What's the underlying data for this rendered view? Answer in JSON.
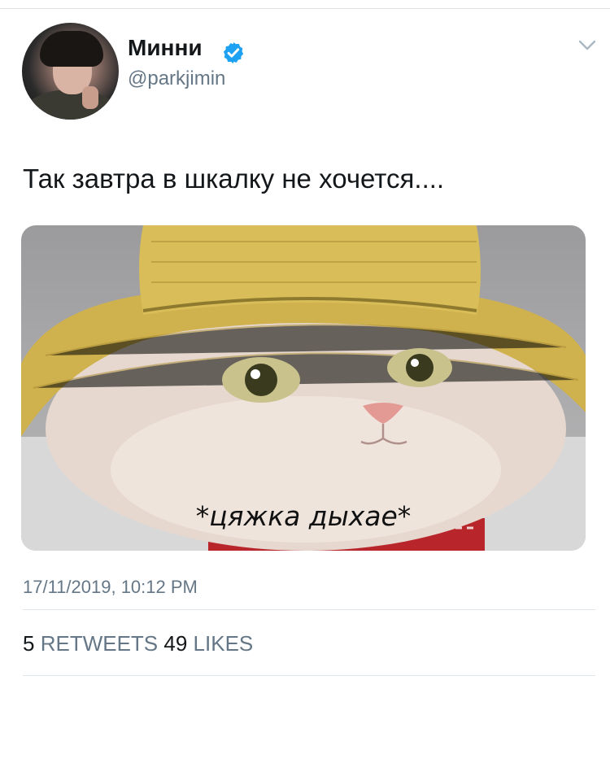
{
  "author": {
    "display_name": "Минни",
    "handle": "@parkjimin",
    "verified_icon": "verified-badge-icon",
    "avatar_icon": "user-avatar"
  },
  "tweet": {
    "text": "Так завтра в шкалку не хочется....",
    "media": {
      "caption": "*цяжка дыхае*"
    },
    "timestamp": "17/11/2019, 10:12 PM"
  },
  "stats": {
    "retweets_count": "5",
    "retweets_label": "RETWEETS",
    "likes_count": "49",
    "likes_label": "LIKES"
  },
  "colors": {
    "verified_blue": "#1da1f2",
    "secondary_text": "#657786",
    "primary_text": "#14171a",
    "divider": "#e1e8ed"
  }
}
